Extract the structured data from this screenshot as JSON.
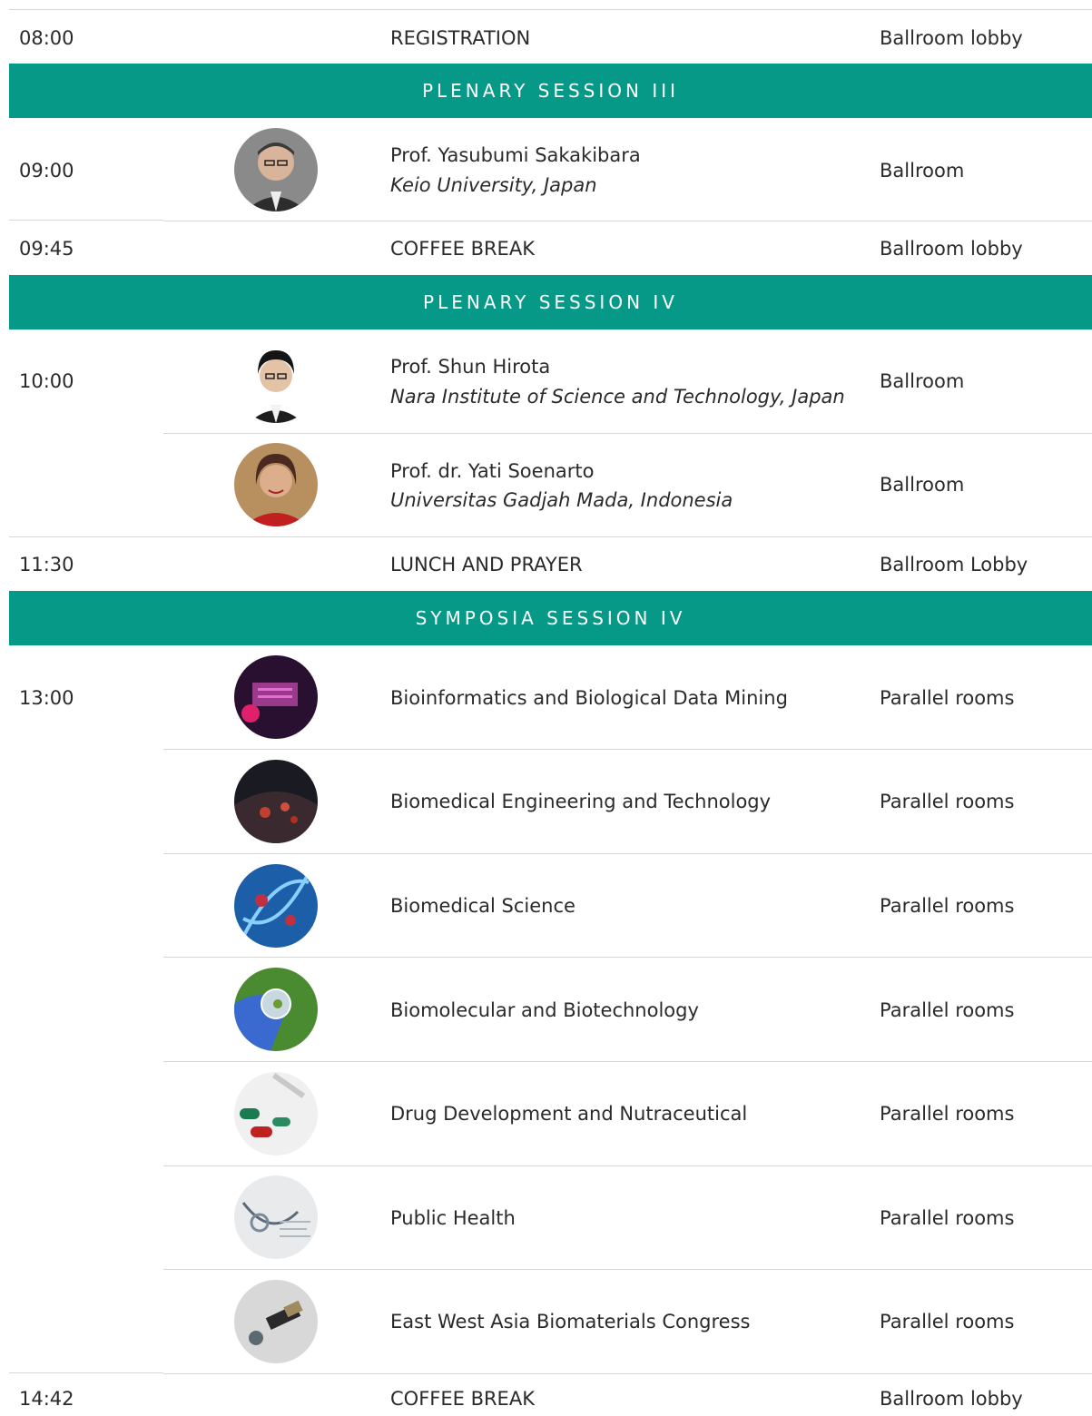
{
  "schedule": {
    "registration": {
      "time": "08:00",
      "title": "REGISTRATION",
      "location": "Ballroom lobby"
    },
    "plenary3": {
      "header": "PLENARY SESSION III",
      "talks": [
        {
          "time": "09:00",
          "name": "Prof. Yasubumi Sakakibara",
          "affiliation": "Keio University, Japan",
          "location": "Ballroom",
          "photo": "speaker-photo"
        }
      ]
    },
    "coffee1": {
      "time": "09:45",
      "title": "COFFEE BREAK",
      "location": "Ballroom lobby"
    },
    "plenary4": {
      "header": "PLENARY SESSION IV",
      "talks": [
        {
          "time": "10:00",
          "name": "Prof. Shun Hirota",
          "affiliation": "Nara Institute of Science and Technology, Japan",
          "location": "Ballroom",
          "photo": "speaker-photo"
        },
        {
          "name": "Prof. dr. Yati Soenarto",
          "affiliation": "Universitas Gadjah Mada, Indonesia",
          "location": "Ballroom",
          "photo": "speaker-photo"
        }
      ]
    },
    "lunch": {
      "time": "11:30",
      "title": "LUNCH AND PRAYER",
      "location": "Ballroom Lobby"
    },
    "symposia4": {
      "header": "SYMPOSIA SESSION IV",
      "time": "13:00",
      "tracks": [
        {
          "title": "Bioinformatics and Biological Data Mining",
          "location": "Parallel rooms"
        },
        {
          "title": "Biomedical Engineering and Technology",
          "location": "Parallel rooms"
        },
        {
          "title": "Biomedical Science",
          "location": "Parallel rooms"
        },
        {
          "title": "Biomolecular and Biotechnology",
          "location": "Parallel rooms"
        },
        {
          "title": "Drug Development and Nutraceutical",
          "location": "Parallel rooms"
        },
        {
          "title": "Public Health",
          "location": "Parallel rooms"
        },
        {
          "title": "East West Asia Biomaterials Congress",
          "location": "Parallel rooms"
        }
      ]
    },
    "coffee2": {
      "time": "14:42",
      "title": "COFFEE BREAK",
      "location": "Ballroom lobby"
    }
  },
  "colors": {
    "band": "#069987",
    "divider": "#d7d7d7"
  }
}
